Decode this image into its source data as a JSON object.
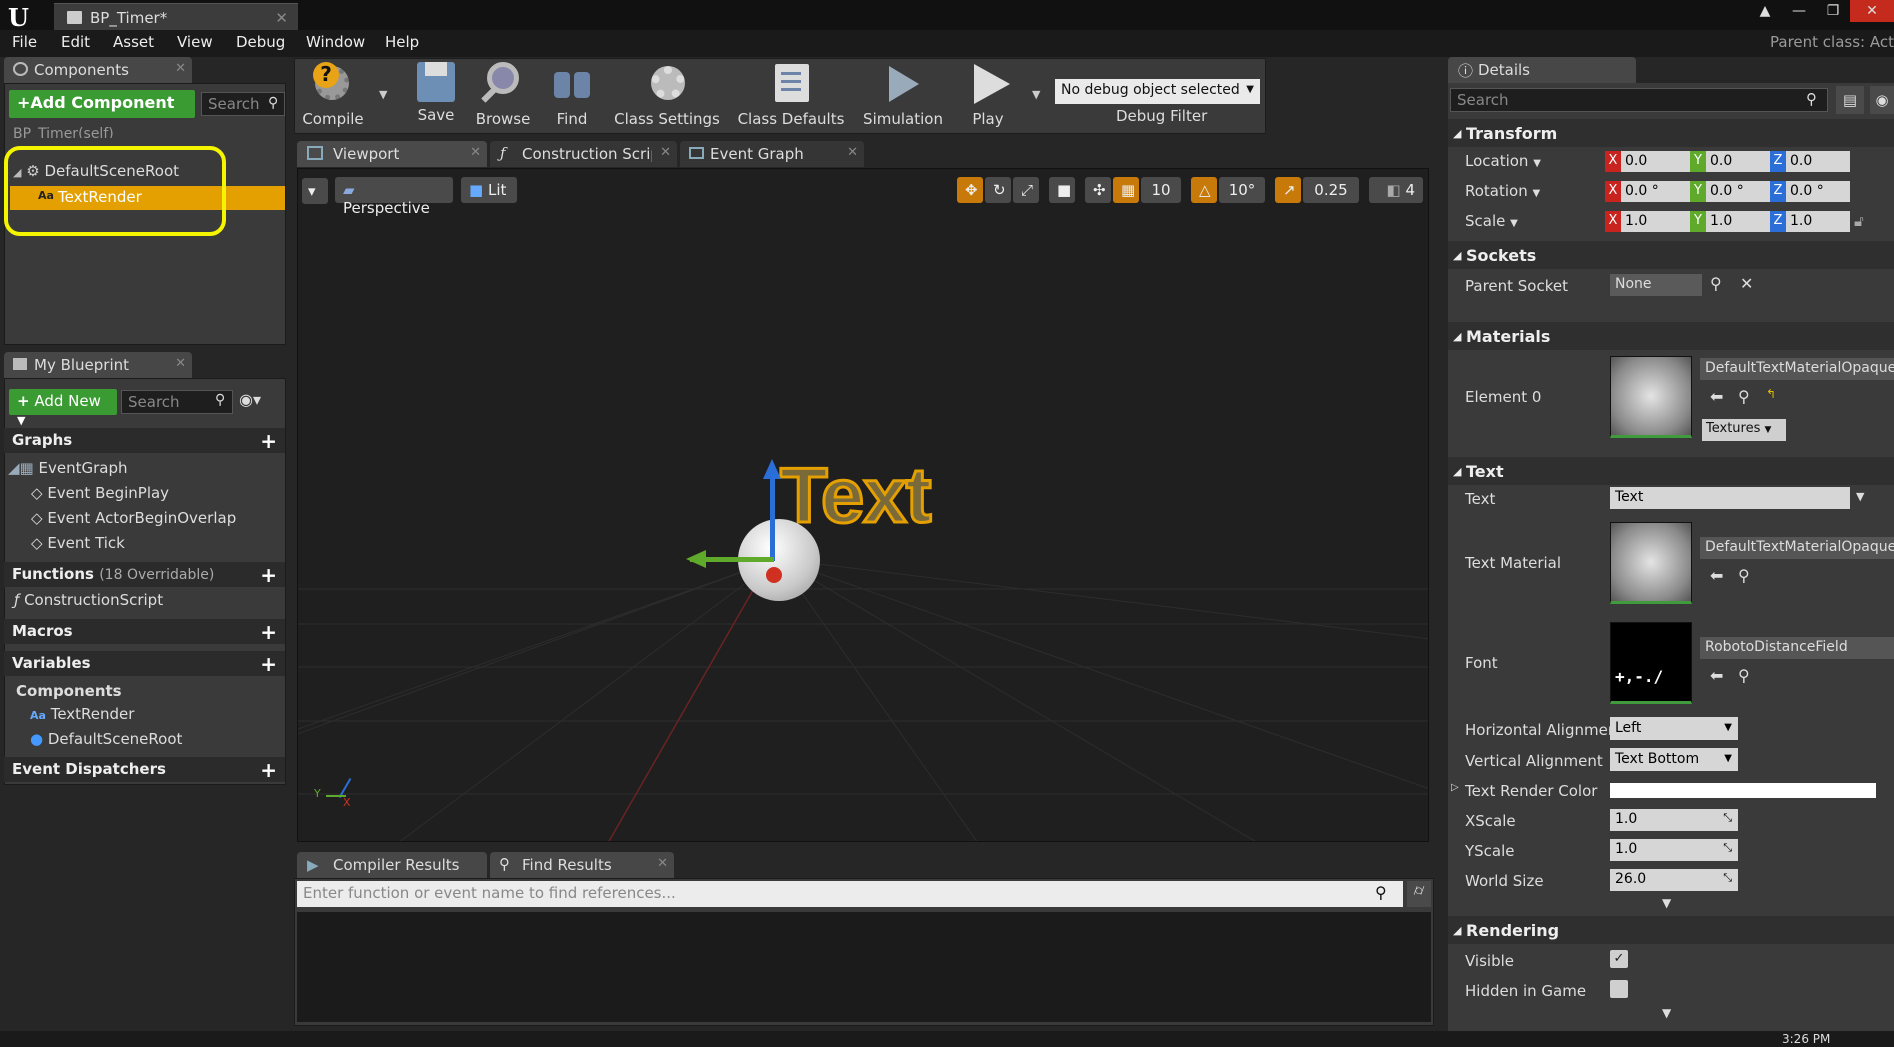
{
  "window": {
    "tab_title": "BP_Timer*",
    "parent_class": "Parent class:  Act"
  },
  "menu": [
    "File",
    "Edit",
    "Asset",
    "View",
    "Debug",
    "Window",
    "Help"
  ],
  "components_panel": {
    "title": "Components",
    "add_button": "+Add Component",
    "search_placeholder": "Search",
    "self_item": "BP_Timer(self)",
    "tree": [
      "DefaultSceneRoot",
      "TextRender"
    ]
  },
  "my_blueprint": {
    "title": "My Blueprint",
    "add_button": "Add New",
    "search_placeholder": "Search",
    "graphs_label": "Graphs",
    "event_graph": "EventGraph",
    "events": [
      "Event BeginPlay",
      "Event ActorBeginOverlap",
      "Event Tick"
    ],
    "functions_label": "Functions",
    "functions_count": "(18 Overridable)",
    "construction_script": "ConstructionScript",
    "macros_label": "Macros",
    "variables_label": "Variables",
    "components_label": "Components",
    "var_components": [
      "TextRender",
      "DefaultSceneRoot"
    ],
    "dispatchers_label": "Event Dispatchers"
  },
  "toolbar": {
    "items": [
      "Compile",
      "Save",
      "Browse",
      "Find",
      "Class Settings",
      "Class Defaults",
      "Simulation",
      "Play"
    ],
    "debug_select": "No debug object selected",
    "debug_filter": "Debug Filter"
  },
  "editor_tabs": [
    "Viewport",
    "Construction Scrip",
    "Event Graph"
  ],
  "viewport": {
    "perspective": "Perspective",
    "lit": "Lit",
    "grid_snap": "10",
    "rot_snap": "10°",
    "scale_snap": "0.25",
    "cam_speed": "4",
    "scene_text": "Text"
  },
  "bottom_panel": {
    "tabs": [
      "Compiler Results",
      "Find Results"
    ],
    "find_placeholder": "Enter function or event name to find references..."
  },
  "details": {
    "title": "Details",
    "search_placeholder": "Search",
    "transform": {
      "label": "Transform",
      "location_label": "Location",
      "rotation_label": "Rotation",
      "scale_label": "Scale",
      "location": [
        "0.0",
        "0.0",
        "0.0"
      ],
      "rotation": [
        "0.0 °",
        "0.0 °",
        "0.0 °"
      ],
      "scale": [
        "1.0",
        "1.0",
        "1.0"
      ]
    },
    "sockets": {
      "label": "Sockets",
      "parent_socket_label": "Parent Socket",
      "parent_socket": "None"
    },
    "materials": {
      "label": "Materials",
      "element0_label": "Element 0",
      "element0": "DefaultTextMaterialOpaque",
      "textures_btn": "Textures"
    },
    "text": {
      "label": "Text",
      "text_label": "Text",
      "text_value": "Text",
      "text_material_label": "Text Material",
      "text_material": "DefaultTextMaterialOpaque",
      "font_label": "Font",
      "font": "RobotoDistanceField",
      "h_align_label": "Horizontal Alignment",
      "h_align": "Left",
      "v_align_label": "Vertical Alignment",
      "v_align": "Text Bottom",
      "color_label": "Text Render Color",
      "xscale_label": "XScale",
      "xscale": "1.0",
      "yscale_label": "YScale",
      "yscale": "1.0",
      "world_size_label": "World Size",
      "world_size": "26.0"
    },
    "rendering": {
      "label": "Rendering",
      "visible_label": "Visible",
      "hidden_label": "Hidden in Game"
    }
  },
  "taskbar": {
    "time": "3:26 PM"
  },
  "colors": {
    "accent_orange": "#e49f00",
    "green_btn": "#3a9b33",
    "highlight_yellow": "#f5f500"
  }
}
